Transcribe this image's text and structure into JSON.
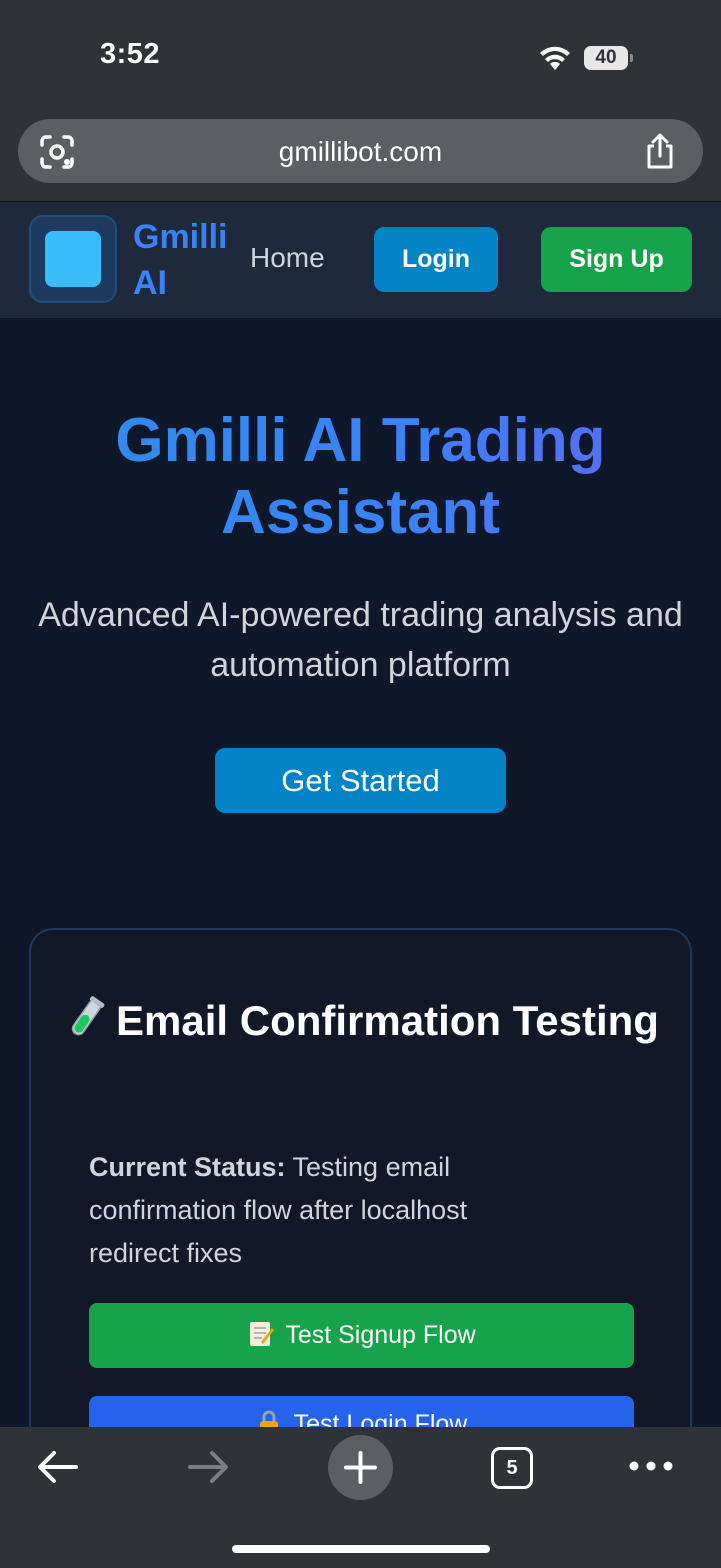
{
  "status_bar": {
    "time": "3:52",
    "battery": "40"
  },
  "browser": {
    "url": "gmillibot.com",
    "tab_count": "5"
  },
  "nav": {
    "brand": "Gmilli AI",
    "home": "Home",
    "login": "Login",
    "signup": "Sign Up"
  },
  "hero": {
    "title": "Gmilli AI Trading Assistant",
    "subtitle": "Advanced AI-powered trading analysis and automation platform",
    "cta": "Get Started"
  },
  "card": {
    "title": "Email Confirmation Testing",
    "status_label": "Current Status:",
    "status_text": " Testing email confirmation flow after localhost redirect fixes",
    "signup_flow": "Test Signup Flow",
    "login_flow": "Test Login Flow"
  },
  "colors": {
    "page_bg": "#0f172a",
    "nav_bg": "#1e293b",
    "primary_blue": "#0284c7",
    "green": "#16a34a",
    "blue": "#2563eb"
  }
}
